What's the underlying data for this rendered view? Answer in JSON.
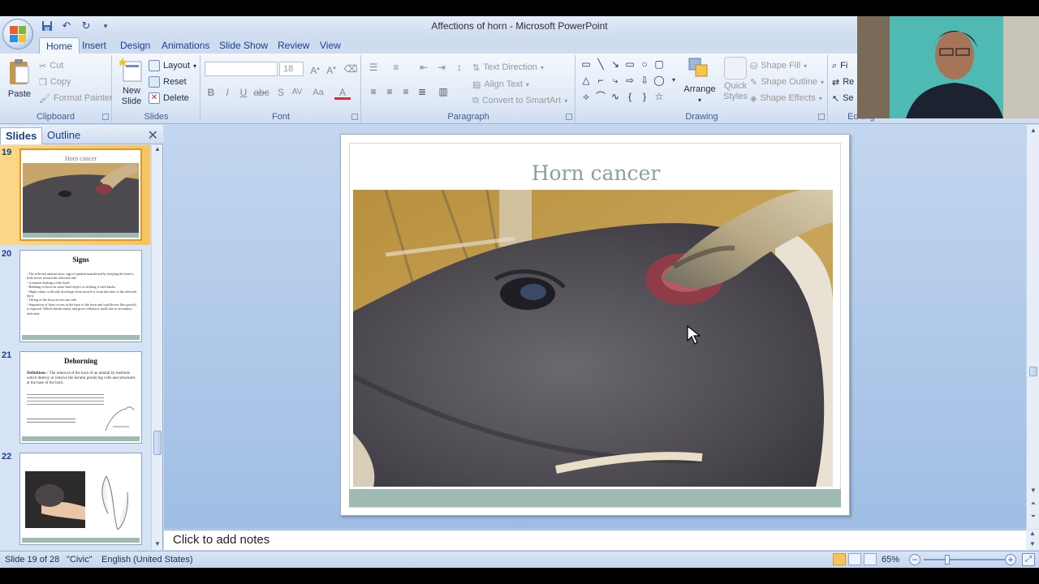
{
  "window": {
    "title": "Affections of horn  - Microsoft PowerPoint"
  },
  "tabs": [
    "Home",
    "Insert",
    "Design",
    "Animations",
    "Slide Show",
    "Review",
    "View"
  ],
  "active_tab": "Home",
  "ribbon": {
    "clipboard": {
      "label": "Clipboard",
      "paste": "Paste",
      "cut": "Cut",
      "copy": "Copy",
      "format_painter": "Format Painter"
    },
    "slides": {
      "label": "Slides",
      "new_slide_line1": "New",
      "new_slide_line2": "Slide",
      "layout": "Layout",
      "reset": "Reset",
      "delete": "Delete"
    },
    "font": {
      "label": "Font",
      "font_name": "",
      "font_size": "18"
    },
    "paragraph": {
      "label": "Paragraph",
      "text_direction": "Text Direction",
      "align_text": "Align Text",
      "convert_smartart": "Convert to SmartArt"
    },
    "drawing": {
      "label": "Drawing",
      "arrange": "Arrange",
      "quick_styles_line1": "Quick",
      "quick_styles_line2": "Styles",
      "shape_fill": "Shape Fill",
      "shape_outline": "Shape Outline",
      "shape_effects": "Shape Effects"
    },
    "editing": {
      "label": "Editing",
      "find": "Fi",
      "replace": "Re",
      "select": "Se"
    }
  },
  "left_pane": {
    "tabs": [
      "Slides",
      "Outline"
    ],
    "active_tab": "Slides",
    "thumbnails": [
      {
        "number": "19",
        "title": "Horn cancer",
        "selected": true
      },
      {
        "number": "20",
        "title": "Signs",
        "lines": [
          "- The affected animal show sign of painful manifested by keeping the head a little lower toward the affected side",
          "- Constant shaking of the head.",
          "- Rubbing of horn on some hard object or striking it with knobs.",
          "- Slight slimy or bloody discharge from nostril or from the base of the affected horn.",
          "- Tilting of the horn on the one side.",
          "- Separation of horn occurs at the base of the horn and cauliflower like growth is exposed. Which bleeds easily and gives offensive smell due to secondary infection."
        ]
      },
      {
        "number": "21",
        "title": "Dehorning",
        "definition_label": "Definitions",
        "definition_text": ":- The removal of the horn of an animal by methods which destroy or remove the keratin producing cells and structures at the base of the horn."
      },
      {
        "number": "22",
        "title": ""
      }
    ]
  },
  "slide": {
    "title": "Horn cancer",
    "image_alt": "buffalo head with cancerous horn base"
  },
  "notes": {
    "placeholder": "Click to add notes"
  },
  "status": {
    "slide_info": "Slide 19 of 28",
    "theme": "\"Civic\"",
    "language": "English (United States)",
    "zoom": "65%"
  }
}
